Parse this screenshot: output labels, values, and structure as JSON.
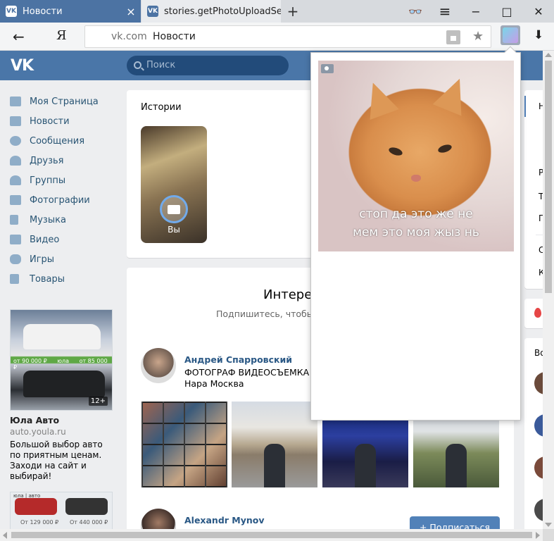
{
  "browser": {
    "tabs": [
      {
        "label": "Новости",
        "favicon": "VK"
      },
      {
        "label": "stories.getPhotoUploadServer",
        "favicon": "VK"
      }
    ],
    "new_tab": "+",
    "toolbar": {
      "ya": "Я",
      "back": "←",
      "star": "★",
      "download": "⬇"
    },
    "window": {
      "mask": "👓",
      "menu": "≡",
      "minimize": "−",
      "maximize": "□",
      "close": "✕"
    },
    "address": {
      "domain": "vk.com",
      "title": "Новости"
    }
  },
  "vk": {
    "logo": "VK",
    "search_placeholder": "Поиск",
    "menu": [
      {
        "label": "Моя Страница",
        "icon": "home-icon"
      },
      {
        "label": "Новости",
        "icon": "news-icon"
      },
      {
        "label": "Сообщения",
        "icon": "messages-icon"
      },
      {
        "label": "Друзья",
        "icon": "friends-icon"
      },
      {
        "label": "Группы",
        "icon": "groups-icon"
      },
      {
        "label": "Фотографии",
        "icon": "camera-icon"
      },
      {
        "label": "Музыка",
        "icon": "music-icon"
      },
      {
        "label": "Видео",
        "icon": "video-icon"
      },
      {
        "label": "Игры",
        "icon": "gamepad-icon"
      },
      {
        "label": "Товары",
        "icon": "bag-icon"
      }
    ],
    "ad": {
      "badge": "12+",
      "title": "Юла Авто",
      "domain": "auto.youla.ru",
      "description": "Большой выбор авто по приятным ценам. Заходи на сайт и выбирай!",
      "price_left": "от 90 000 ₽",
      "brand": "юла",
      "price_right": "от 85 000 ₽"
    },
    "ad2": {
      "price_left": "От 129 000 ₽",
      "price_right": "От 440 000 ₽",
      "brand": "юла | авто"
    },
    "stories": {
      "title": "Истории",
      "own_label": "Вы"
    },
    "recommendations": {
      "title": "Интерес",
      "subtitle": "Подпишитесь, чтобы н",
      "people": [
        {
          "name": "Андрей Спарровский",
          "line1": "ФОТОГРАФ ВИДЕОСЪЕМКА С",
          "line2": "Нара Москва"
        },
        {
          "name": "Alexandr Mynov"
        }
      ],
      "subscribe": "+ Подписаться"
    },
    "right_column": {
      "letters": [
        "Н",
        "Р",
        "Т",
        "П",
        "С",
        "К"
      ],
      "header": "Во"
    }
  },
  "popup": {
    "meme_line1": "стоп да это же не",
    "meme_line2": "мем это моя жыз нь"
  }
}
